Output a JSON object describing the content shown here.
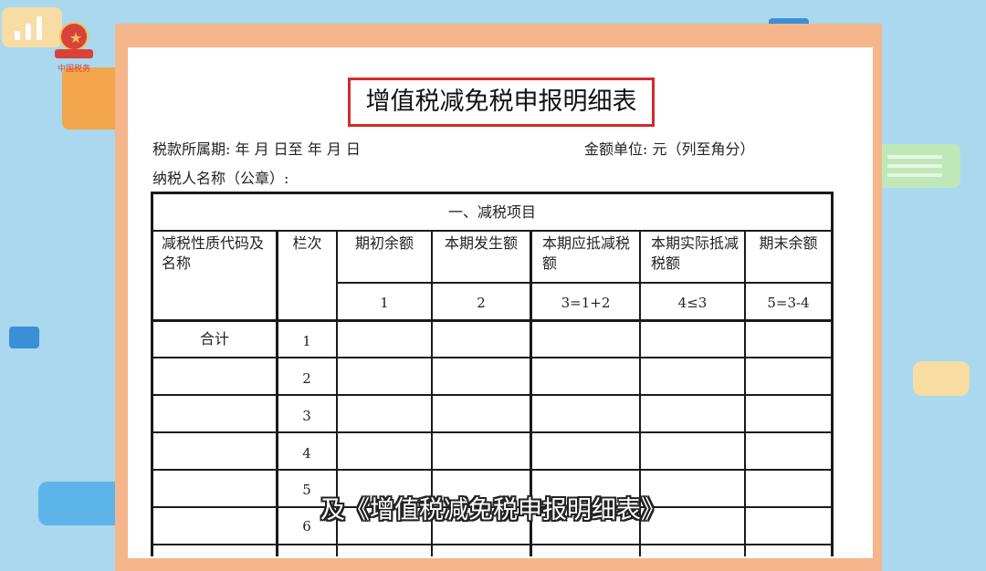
{
  "emblem_caption": "中国税务",
  "form": {
    "title": "增值税减免税申报明细表",
    "period_label": "税款所属期:  年  月  日至  年  月   日",
    "unit_label": "金额单位:  元（列至角分）",
    "taxpayer_label": "纳税人名称（公章）:"
  },
  "table": {
    "section_header": "一、减税项目",
    "columns": [
      {
        "label": "减税性质代码及名称",
        "index": ""
      },
      {
        "label": "栏次",
        "index": ""
      },
      {
        "label": "期初余额",
        "index": "1"
      },
      {
        "label": "本期发生额",
        "index": "2"
      },
      {
        "label": "本期应抵减税额",
        "index": "3=1+2"
      },
      {
        "label": "本期实际抵减税额",
        "index": "4≤3"
      },
      {
        "label": "期末余额",
        "index": "5=3-4"
      }
    ],
    "rows": [
      {
        "name": "合计",
        "line": "1"
      },
      {
        "name": "",
        "line": "2"
      },
      {
        "name": "",
        "line": "3"
      },
      {
        "name": "",
        "line": "4"
      },
      {
        "name": "",
        "line": "5"
      },
      {
        "name": "",
        "line": "6"
      }
    ]
  },
  "subtitle": "及《增值税减免税申报明细表》",
  "colors": {
    "background": "#a9d8ef",
    "paper_border": "#f4b68a",
    "title_border": "#d42a2a"
  }
}
